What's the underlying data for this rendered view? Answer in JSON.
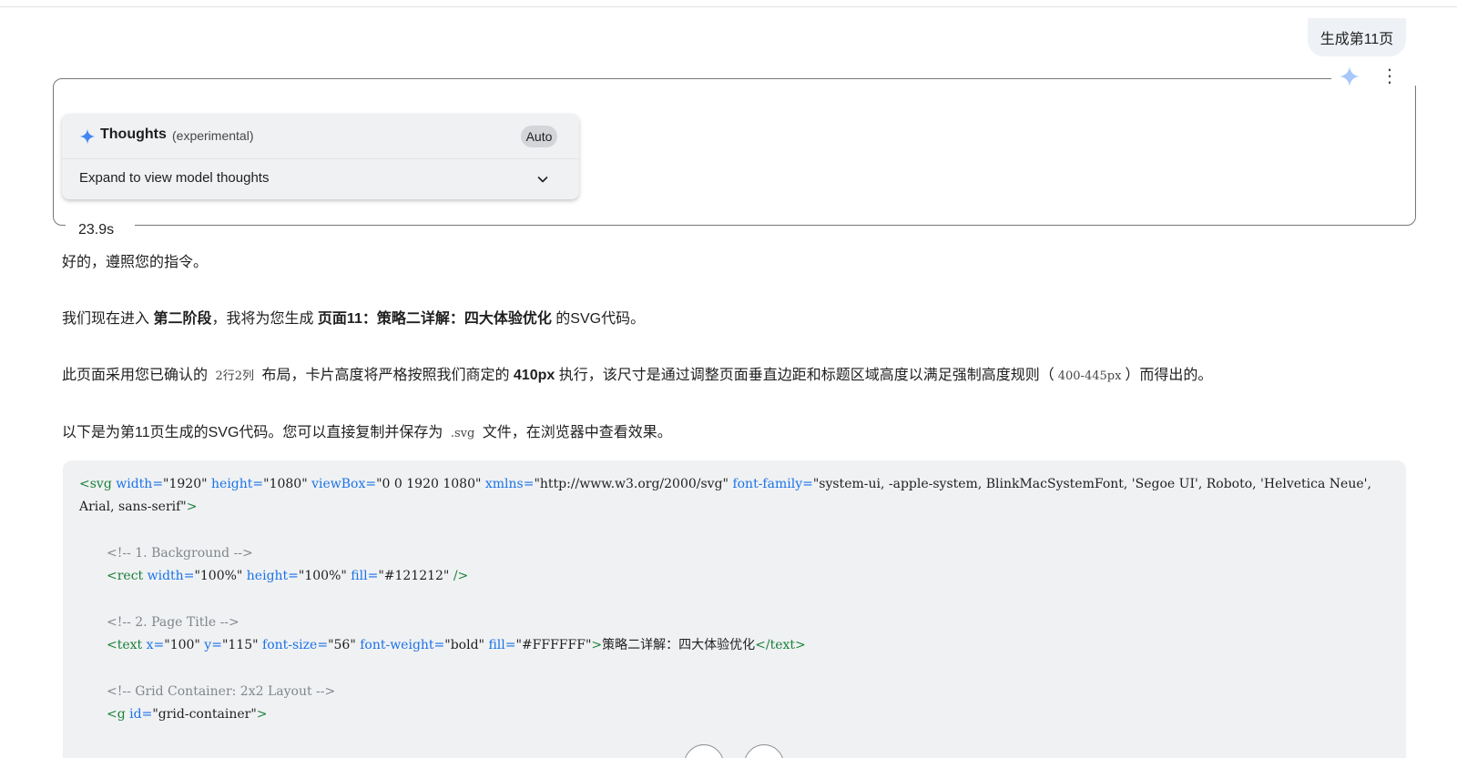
{
  "user_message": "生成第11页",
  "thoughts": {
    "title": "Thoughts",
    "subtitle": "(experimental)",
    "mode": "Auto",
    "expand_label": "Expand to view model thoughts"
  },
  "timing": "23.9s",
  "response": {
    "p1": "好的，遵照您的指令。",
    "p2": {
      "t1": "我们现在进入 ",
      "b1": "第二阶段",
      "t2": "，我将为您生成 ",
      "b2": "页面11：策略二详解：四大体验优化",
      "t3": " 的SVG代码。"
    },
    "p3": {
      "t1": "此页面采用您已确认的 ",
      "c1": "2行2列",
      "t2": " 布局，卡片高度将严格按照我们商定的 ",
      "b1": "410px",
      "t3": " 执行，该尺寸是通过调整页面垂直边距和标题区域高度以满足强制高度规则（",
      "c2": "400-445px",
      "t4": "）而得出的。"
    },
    "p4": {
      "t1": "以下是为第11页生成的SVG代码。您可以直接复制并保存为 ",
      "c1": ".svg",
      "t2": " 文件，在浏览器中查看效果。"
    }
  },
  "code": {
    "l1": {
      "tag_open": "<svg",
      "a1": " width=",
      "v1": "\"1920\"",
      "a2": " height=",
      "v2": "\"1080\"",
      "a3": " viewBox=",
      "v3": "\"0 0 1920 1080\"",
      "a4": " xmlns=",
      "v4": "\"http://www.w3.org/2000/svg\"",
      "a5": " font-family=",
      "v5": "\"system-ui, -apple-system, BlinkMacSystemFont, 'Segoe UI', Roboto, 'Helvetica Neue',"
    },
    "l2": {
      "v": "Arial, sans-serif\"",
      "close": ">"
    },
    "l3": "<!-- 1. Background -->",
    "l4": {
      "tag_open": "<rect",
      "a1": " width=",
      "v1": "\"100%\"",
      "a2": " height=",
      "v2": "\"100%\"",
      "a3": " fill=",
      "v3": "\"#121212\"",
      "close": " />"
    },
    "l5": "<!-- 2. Page Title -->",
    "l6": {
      "tag_open": "<text",
      "a1": " x=",
      "v1": "\"100\"",
      "a2": " y=",
      "v2": "\"115\"",
      "a3": " font-size=",
      "v3": "\"56\"",
      "a4": " font-weight=",
      "v4": "\"bold\"",
      "a5": " fill=",
      "v5": "\"#FFFFFF\"",
      "gt": ">",
      "content": "策略二详解：四大体验优化",
      "tag_close": "</text>"
    },
    "l7": "<!-- Grid Container: 2x2 Layout -->",
    "l8": {
      "tag_open": "<g",
      "a1": " id=",
      "v1": "\"grid-container\"",
      "close": ">"
    }
  },
  "colors": {
    "accent_blue": "#4285f4",
    "tag_green": "#188038",
    "attr_blue": "#1a73e8",
    "comment_gray": "#80868b"
  },
  "icons": {
    "spark": "spark-icon",
    "more": "more-vert-icon",
    "chevron": "chevron-down-icon"
  }
}
